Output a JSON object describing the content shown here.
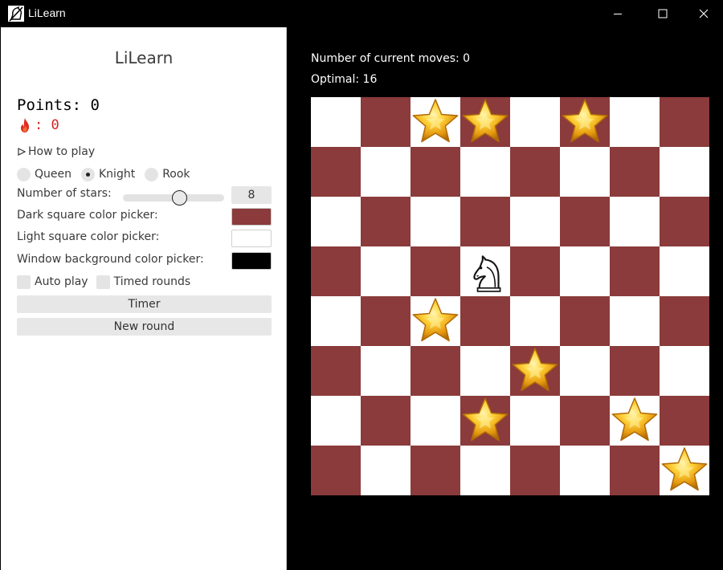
{
  "window": {
    "title": "LiLearn",
    "controls": [
      "minimize-icon",
      "maximize-icon",
      "close-icon"
    ]
  },
  "sidebar": {
    "heading": "LiLearn",
    "points_label": "Points: 0",
    "streak_value": ": 0",
    "how_to_play": "How to play",
    "piece_options": [
      {
        "label": "Queen",
        "selected": false
      },
      {
        "label": "Knight",
        "selected": true
      },
      {
        "label": "Rook",
        "selected": false
      }
    ],
    "stars_label": "Number of stars:",
    "stars_value": "8",
    "stars_fraction": 0.57,
    "dark_color_label": "Dark square color picker:",
    "light_color_label": "Light square color picker:",
    "window_color_label": "Window background color picker:",
    "auto_play_label": "Auto play",
    "timed_rounds_label": "Timed rounds",
    "timer_button": "Timer",
    "new_round_button": "New round"
  },
  "colors": {
    "dark_square": "#8b3b3b",
    "light_square": "#ffffff",
    "window_background": "#000000",
    "streak": "#d42424"
  },
  "main": {
    "current_moves": "Number of current moves: 0",
    "optimal": "Optimal: 16"
  },
  "board": {
    "size": 8,
    "piece": {
      "type": "knight",
      "icon": "knight-icon",
      "row": 3,
      "col": 3
    },
    "stars": [
      {
        "row": 0,
        "col": 2
      },
      {
        "row": 0,
        "col": 3
      },
      {
        "row": 0,
        "col": 5
      },
      {
        "row": 4,
        "col": 2
      },
      {
        "row": 5,
        "col": 4
      },
      {
        "row": 6,
        "col": 3
      },
      {
        "row": 6,
        "col": 6
      },
      {
        "row": 7,
        "col": 7
      }
    ]
  }
}
